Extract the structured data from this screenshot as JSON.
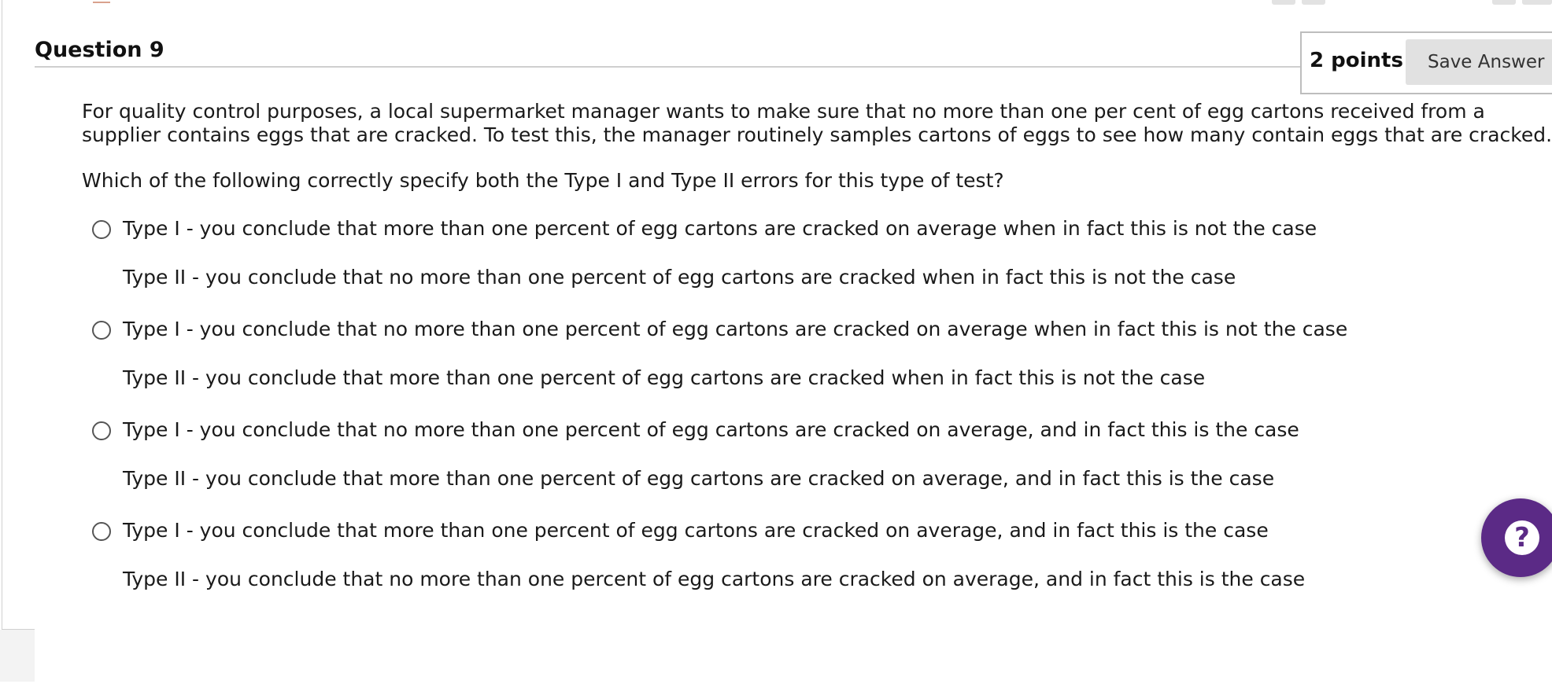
{
  "question": {
    "title": "Question 9",
    "points": "2 points",
    "save_label": "Save Answer"
  },
  "stem": {
    "line1": "For quality control purposes, a local supermarket manager wants to make sure that no more than one per cent of egg cartons received from a",
    "line2": "supplier contains eggs that are cracked. To test this, the manager routinely samples cartons of eggs to see how many contain eggs that are cracked.",
    "prompt": "Which of the following correctly specify both the Type I and Type II errors for this type of test?"
  },
  "options": [
    {
      "type1": "Type I - you conclude that more than one percent of egg cartons are cracked on average when in fact this is not the case",
      "type2": "Type II - you conclude that no more than one percent of egg cartons are cracked when in fact this is not the case"
    },
    {
      "type1": "Type I - you conclude that no more than one percent of egg cartons are cracked on average when in fact this is not the case",
      "type2": "Type II - you conclude that more than one percent of egg cartons are cracked when in fact this is not the case"
    },
    {
      "type1": "Type I - you conclude that no more than one percent of egg cartons are cracked on average, and in fact this is the case",
      "type2": "Type II - you conclude that more than one percent of egg cartons are cracked on average, and in fact this is the case"
    },
    {
      "type1": "Type I - you conclude that more than one percent of egg cartons are cracked on average, and in fact this is the case",
      "type2": "Type II - you conclude that no more than one percent of egg cartons are cracked on average, and in fact this is the case"
    }
  ],
  "help": {
    "icon": "question-mark-icon",
    "glyph": "?",
    "color": "#5b2a86"
  }
}
